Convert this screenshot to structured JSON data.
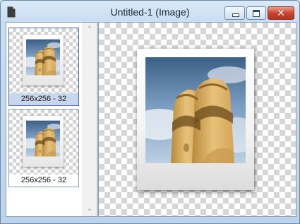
{
  "window": {
    "title": "Untitled-1 (Image)",
    "icons": {
      "document": "document-icon",
      "minimize": "minimize-icon",
      "maximize": "maximize-icon",
      "close": "close-icon"
    },
    "close_glyph": "✕",
    "accent_close": "#c9452f"
  },
  "image_list": {
    "items": [
      {
        "label": "256x256 - 32",
        "selected": true
      },
      {
        "label": "256x256 - 32",
        "selected": false
      }
    ],
    "scroll_up": "⌃",
    "scroll_down": "⌄"
  }
}
